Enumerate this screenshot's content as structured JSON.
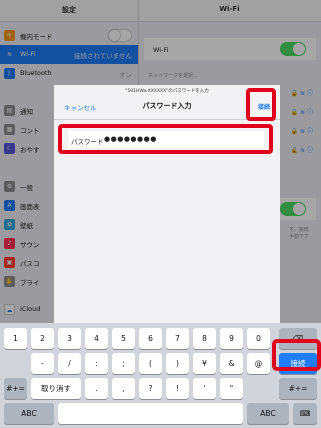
{
  "topbar": {
    "left_title": "設定",
    "right_title": "Wi-Fi"
  },
  "settings": {
    "airplane": "機内モード",
    "wifi": "Wi-Fi",
    "wifi_value": "接続されていません",
    "bluetooth": "Bluetooth",
    "bluetooth_value": "オン",
    "notifications": "通知",
    "control": "コント",
    "dnd": "おやす",
    "general": "一般",
    "display": "画面表",
    "wallpaper": "壁紙",
    "sound": "サウン",
    "passcode": "パスコ",
    "privacy": "プライ",
    "icloud": "iCloud"
  },
  "wifi_panel": {
    "wifi_label": "Wi-Fi",
    "choose_network": "ネットワークを選択...",
    "hint": "す。接続\n手動です"
  },
  "modal": {
    "subtitle": "\"501HWa-XXXXXX\"のパスワードを入力",
    "cancel": "キャンセル",
    "title": "パスワード入力",
    "connect": "接続",
    "password_label": "パスワード",
    "password_value": "●●●●●●●●"
  },
  "keyboard": {
    "row1": [
      "1",
      "2",
      "3",
      "4",
      "5",
      "6",
      "7",
      "8",
      "9",
      "0",
      "⌫"
    ],
    "row2": [
      "-",
      "/",
      ":",
      ";",
      "(",
      ")",
      "¥",
      "&",
      "@",
      "接続"
    ],
    "row3": [
      "#+=",
      "取り消す",
      ".",
      ",",
      "?",
      "!",
      "'",
      "\"",
      "#+="
    ],
    "row4": [
      "ABC",
      "",
      "ABC",
      "⌨"
    ]
  },
  "colors": {
    "accent": "#1e7cf5",
    "highlight": "#e0001b",
    "toggle_on": "#4cd964"
  }
}
